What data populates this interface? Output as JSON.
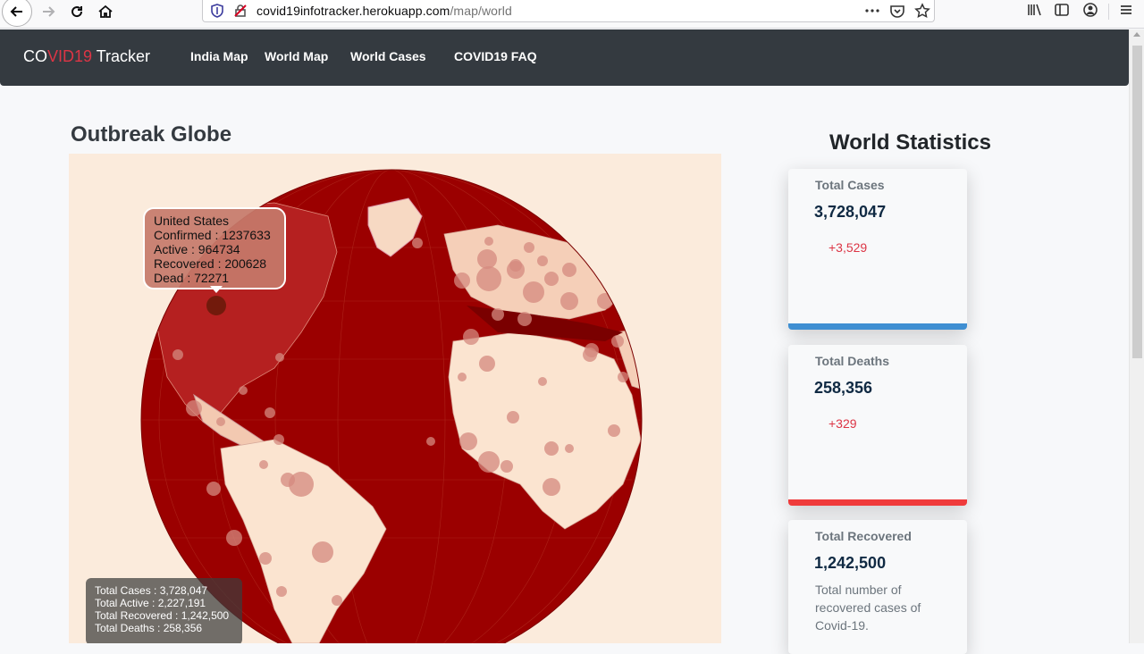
{
  "browser": {
    "url_host": "covid19infotracker.herokuapp.com",
    "url_path": "/map/world"
  },
  "navbar": {
    "brand_co": "CO",
    "brand_vid": "VID19",
    "brand_rest": " Tracker",
    "links": [
      "India Map",
      "World Map",
      "World Cases",
      "COVID19 FAQ"
    ]
  },
  "globe": {
    "title": "Outbreak Globe",
    "tooltip": {
      "country": "United States",
      "confirmed": "Confirmed : 1237633",
      "active": "Active : 964734",
      "recovered": "Recovered : 200628",
      "dead": "Dead : 72271"
    },
    "totals": {
      "cases": "Total Cases : 3,728,047",
      "active": "Total Active : 2,227,191",
      "recovered": "Total Recovered : 1,242,500",
      "deaths": "Total Deaths : 258,356"
    },
    "colors": {
      "ocean": "#9b0000",
      "land": "#fbe4d0",
      "background": "#fbebdc",
      "bubble": "#d48a7f"
    }
  },
  "stats": {
    "title": "World Statistics",
    "cards": [
      {
        "label": "Total Cases",
        "value": "3,728,047",
        "delta": "+3,529",
        "bar_color": "#3f8fd2"
      },
      {
        "label": "Total Deaths",
        "value": "258,356",
        "delta": "+329",
        "bar_color": "#ef3b3b"
      },
      {
        "label": "Total Recovered",
        "value": "1,242,500",
        "desc": "Total number of recovered cases of Covid-19."
      }
    ]
  }
}
